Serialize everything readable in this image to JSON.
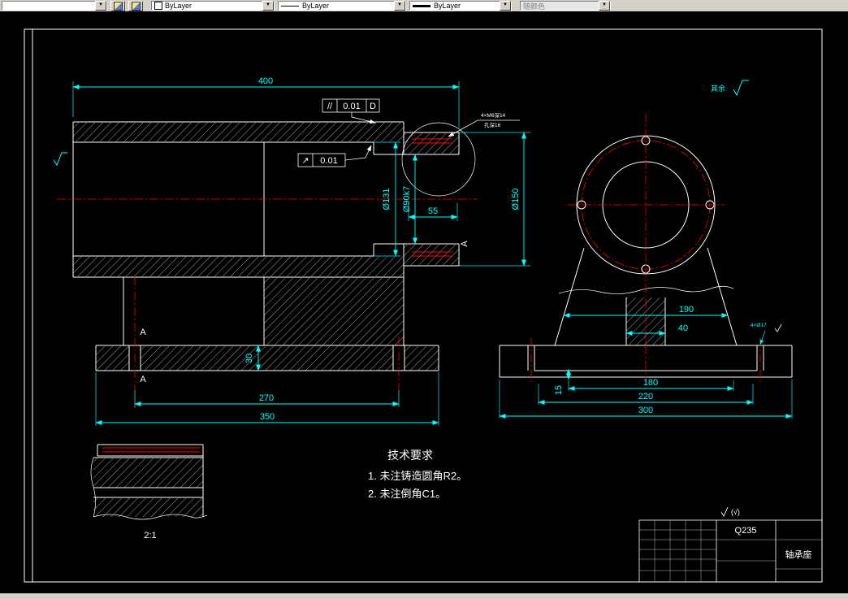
{
  "toolbar": {
    "color_value": "ByLayer",
    "linetype_value": "ByLayer",
    "lineweight_value": "ByLayer",
    "plotstyle_value": "随颜色"
  },
  "drawing": {
    "colors": {
      "dimension": "#00ffff",
      "object": "#ffffff",
      "centerline": "#ff0000",
      "background": "#000000"
    },
    "dimensions": {
      "length_overall": "400",
      "flange_width": "55",
      "bore_large": "Ø131",
      "bore_fit": "Ø90k7",
      "flange_od": "Ø150",
      "base_thickness": "30",
      "bolt_spacing_side": "270",
      "base_length": "350",
      "top_width": "190",
      "rib_width": "40",
      "pad_span": "180",
      "bolt_spacing_front": "220",
      "base_width": "300",
      "pad_height": "15"
    },
    "tolerances": {
      "parallelism_symbol": "//",
      "parallelism_value": "0.01",
      "parallelism_datum": "D",
      "runout_symbol": "↗",
      "runout_value": "0.01"
    },
    "callouts": {
      "flange_holes_line1": "4×M6深14",
      "flange_holes_line2": "孔深16",
      "base_holes": "4×Ø17",
      "surface_default_prefix": "其余",
      "surface_note": "(√)"
    },
    "labels": {
      "detail_scale": "2:1",
      "section_a_top": "A",
      "section_a_bottom": "A",
      "section_a_side": "A"
    },
    "tech_requirements": {
      "title": "技术要求",
      "item1": "1. 未注铸造圆角R2。",
      "item2": "2. 未注倒角C1。"
    },
    "title_block": {
      "material": "Q235",
      "part_name": "轴承座"
    }
  }
}
